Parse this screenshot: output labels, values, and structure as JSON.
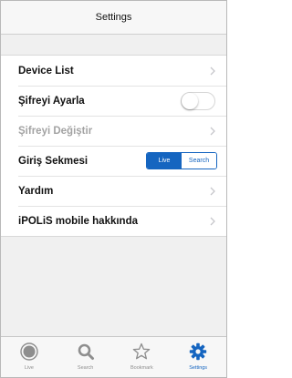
{
  "navbar": {
    "title": "Settings"
  },
  "rows": [
    {
      "label": "Device List",
      "control": "chevron",
      "disabled": false
    },
    {
      "label": "Şifreyi Ayarla",
      "control": "toggle",
      "toggle_on": false
    },
    {
      "label": "Şifreyi Değiştir",
      "control": "chevron",
      "disabled": true
    },
    {
      "label": "Giriş Sekmesi",
      "control": "segmented",
      "segments": [
        "Live",
        "Search"
      ],
      "selected": "Live"
    },
    {
      "label": "Yardım",
      "control": "chevron",
      "disabled": false
    },
    {
      "label": "iPOLiS mobile hakkında",
      "control": "chevron",
      "disabled": false
    }
  ],
  "tabbar": {
    "tabs": [
      {
        "label": "Live",
        "icon": "live-circle-icon",
        "active": false
      },
      {
        "label": "Search",
        "icon": "search-icon",
        "active": false
      },
      {
        "label": "Bookmark",
        "icon": "star-icon",
        "active": false
      },
      {
        "label": "Settings",
        "icon": "gear-icon",
        "active": true
      }
    ]
  },
  "colors": {
    "accent": "#1565c0",
    "inactive_icon": "#8e8e8e",
    "chevron": "#c7c7cc"
  }
}
